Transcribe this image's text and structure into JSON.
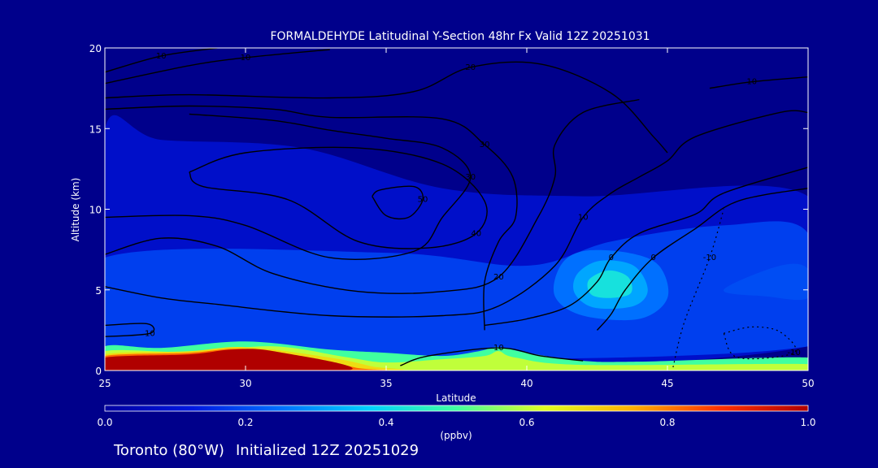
{
  "chart_data": {
    "type": "heatmap",
    "title": "FORMALDEHYDE Latitudinal Y-Section 48hr  Fx Valid 12Z 20251031",
    "xlabel": "Latitude",
    "ylabel": "Altitude (km)",
    "xlim": [
      25,
      50
    ],
    "ylim": [
      0,
      20
    ],
    "x_ticks": [
      "25",
      "30",
      "35",
      "40",
      "45",
      "50"
    ],
    "y_ticks": [
      "0",
      "5",
      "10",
      "15",
      "20"
    ],
    "colorbar": {
      "ticks": [
        "0.0",
        "0.2",
        "0.4",
        "0.6",
        "0.8",
        "1.0"
      ],
      "range": [
        0,
        1
      ],
      "unit": "(ppbv)",
      "colors": [
        "#0000a0",
        "#0018e0",
        "#0070ff",
        "#00d0ff",
        "#40ffa0",
        "#e0ff20",
        "#ffb000",
        "#ff3000",
        "#b00000"
      ]
    },
    "background_color": "#00008b",
    "filled_regions": [
      {
        "value": 0.08,
        "points": [
          [
            25,
            15
          ],
          [
            27,
            14.3
          ],
          [
            32,
            13.8
          ],
          [
            37,
            11.3
          ],
          [
            42,
            10.8
          ],
          [
            50,
            10.8
          ],
          [
            50,
            1.5
          ],
          [
            25,
            1.5
          ]
        ]
      },
      {
        "value": 0.18,
        "points": [
          [
            25,
            7
          ],
          [
            35,
            7.3
          ],
          [
            40,
            6.5
          ],
          [
            43,
            8
          ],
          [
            47,
            9
          ],
          [
            50,
            8.5
          ],
          [
            50,
            1.5
          ],
          [
            25,
            1.5
          ]
        ]
      },
      {
        "value": 0.25,
        "points": [
          [
            41.2,
            6.5
          ],
          [
            42,
            7.4
          ],
          [
            43.6,
            7.3
          ],
          [
            44.7,
            6.5
          ],
          [
            45,
            4.5
          ],
          [
            44,
            3.2
          ],
          [
            42,
            3.4
          ],
          [
            41,
            4.6
          ]
        ]
      },
      {
        "value": 0.32,
        "points": [
          [
            41.8,
            6
          ],
          [
            42.6,
            6.8
          ],
          [
            43.8,
            6.5
          ],
          [
            44.3,
            5
          ],
          [
            43.8,
            4
          ],
          [
            42.4,
            3.9
          ],
          [
            41.7,
            4.8
          ]
        ]
      },
      {
        "value": 0.42,
        "points": [
          [
            42.2,
            5.6
          ],
          [
            42.9,
            6.2
          ],
          [
            43.6,
            5.8
          ],
          [
            43.7,
            4.8
          ],
          [
            43,
            4.5
          ],
          [
            42.3,
            4.7
          ]
        ]
      },
      {
        "value": 0.2,
        "points": [
          [
            47,
            5
          ],
          [
            49,
            6.5
          ],
          [
            50,
            6.3
          ],
          [
            50,
            4.5
          ],
          [
            48.5,
            4.6
          ]
        ]
      },
      {
        "value": 0.5,
        "points": [
          [
            25,
            1.5
          ],
          [
            27,
            1.4
          ],
          [
            30,
            1.8
          ],
          [
            33,
            1.3
          ],
          [
            35,
            1.1
          ],
          [
            37,
            0.9
          ],
          [
            38.3,
            1.2
          ],
          [
            39,
            1.45
          ],
          [
            40,
            1.1
          ],
          [
            42,
            0.6
          ],
          [
            44,
            0.55
          ],
          [
            50,
            0.8
          ],
          [
            50,
            0
          ],
          [
            25,
            0
          ]
        ]
      },
      {
        "value": 0.6,
        "points": [
          [
            25,
            1.2
          ],
          [
            28,
            1.15
          ],
          [
            31,
            1.5
          ],
          [
            33.5,
            0.85
          ],
          [
            35,
            0.5
          ],
          [
            37,
            0.7
          ],
          [
            38.5,
            0.9
          ],
          [
            39,
            1.2
          ],
          [
            39.6,
            0.8
          ],
          [
            42,
            0.35
          ],
          [
            50,
            0.4
          ],
          [
            50,
            0
          ],
          [
            25,
            0
          ]
        ]
      },
      {
        "value": 0.68,
        "points": [
          [
            25,
            1.0
          ],
          [
            28,
            1.2
          ],
          [
            30,
            1.45
          ],
          [
            33,
            0.8
          ],
          [
            34.5,
            0.25
          ],
          [
            35,
            0
          ],
          [
            25,
            0
          ]
        ]
      },
      {
        "value": 0.82,
        "points": [
          [
            25,
            0.9
          ],
          [
            28,
            1.1
          ],
          [
            30,
            1.35
          ],
          [
            32.5,
            0.7
          ],
          [
            34,
            0.15
          ],
          [
            34.5,
            0
          ],
          [
            25,
            0
          ]
        ]
      },
      {
        "value": 1.0,
        "points": [
          [
            25,
            0.8
          ],
          [
            28,
            1.0
          ],
          [
            29.5,
            1.3
          ],
          [
            31,
            1.2
          ],
          [
            33.6,
            0
          ],
          [
            25,
            0
          ]
        ]
      }
    ],
    "contours": [
      {
        "label": "10",
        "style": "solid",
        "points": [
          [
            25,
            18.5
          ],
          [
            27,
            19.5
          ],
          [
            29,
            20
          ]
        ]
      },
      {
        "label": "10",
        "style": "solid",
        "points": [
          [
            25,
            17.8
          ],
          [
            28,
            18.9
          ],
          [
            30,
            19.4
          ],
          [
            33,
            19.9
          ]
        ]
      },
      {
        "label": "20",
        "style": "solid",
        "points": [
          [
            25,
            16.9
          ],
          [
            28,
            17.1
          ],
          [
            33,
            16.9
          ],
          [
            36,
            17.3
          ],
          [
            38,
            18.8
          ],
          [
            40.5,
            19
          ],
          [
            43,
            17.2
          ],
          [
            44.5,
            14.5
          ],
          [
            45,
            13.5
          ]
        ]
      },
      {
        "label": "30",
        "style": "solid",
        "points": [
          [
            25,
            16.2
          ],
          [
            28,
            16.4
          ],
          [
            31,
            16.2
          ],
          [
            33,
            15.7
          ],
          [
            37,
            15.6
          ],
          [
            38.5,
            14
          ],
          [
            39.5,
            12
          ],
          [
            39.6,
            9.5
          ],
          [
            39,
            8
          ],
          [
            38.5,
            5.5
          ],
          [
            38.5,
            2.5
          ]
        ]
      },
      {
        "label": "40",
        "style": "solid",
        "points": [
          [
            28,
            12.3
          ],
          [
            30,
            13.5
          ],
          [
            34,
            13.8
          ],
          [
            37,
            12.8
          ],
          [
            38.5,
            10.5
          ],
          [
            38.2,
            8.5
          ],
          [
            36.5,
            7.6
          ],
          [
            34,
            8
          ],
          [
            31.5,
            10.6
          ],
          [
            28.5,
            11.4
          ],
          [
            28,
            12.3
          ]
        ]
      },
      {
        "label": "50",
        "style": "solid",
        "points": [
          [
            34.5,
            10.8
          ],
          [
            34.8,
            11.2
          ],
          [
            36,
            11.4
          ],
          [
            36.3,
            10.6
          ],
          [
            35.8,
            9.5
          ],
          [
            35,
            9.6
          ],
          [
            34.5,
            10.8
          ]
        ]
      },
      {
        "label": "30",
        "style": "solid",
        "points": [
          [
            25,
            9.5
          ],
          [
            28,
            9.6
          ],
          [
            30,
            9
          ],
          [
            33,
            7
          ],
          [
            36,
            7.4
          ],
          [
            37,
            9.5
          ],
          [
            38,
            12
          ],
          [
            37,
            13.8
          ],
          [
            35,
            14.4
          ],
          [
            33,
            14.9
          ],
          [
            31,
            15.5
          ],
          [
            28,
            15.9
          ]
        ]
      },
      {
        "label": "20",
        "style": "solid",
        "points": [
          [
            25,
            7.2
          ],
          [
            27,
            8.2
          ],
          [
            29,
            7.7
          ],
          [
            31,
            6
          ],
          [
            34,
            4.9
          ],
          [
            37,
            4.9
          ],
          [
            39,
            5.8
          ],
          [
            40.4,
            9.5
          ],
          [
            41,
            12
          ],
          [
            41,
            14
          ],
          [
            42,
            16
          ],
          [
            44,
            16.8
          ]
        ]
      },
      {
        "label": "10",
        "style": "solid",
        "points": [
          [
            25,
            5.2
          ],
          [
            27,
            4.5
          ],
          [
            29,
            4.1
          ],
          [
            33,
            3.4
          ],
          [
            37,
            3.4
          ],
          [
            39,
            4
          ],
          [
            41,
            6.5
          ],
          [
            42,
            9.5
          ],
          [
            43,
            11
          ],
          [
            44,
            12
          ],
          [
            45,
            13
          ],
          [
            46,
            14.5
          ],
          [
            49,
            16
          ],
          [
            50,
            16
          ]
        ]
      },
      {
        "label": "0",
        "style": "solid",
        "points": [
          [
            38.5,
            2.8
          ],
          [
            40,
            3.2
          ],
          [
            41.5,
            4
          ],
          [
            42.5,
            5.5
          ],
          [
            43,
            7
          ],
          [
            44,
            8.5
          ],
          [
            46,
            9.7
          ],
          [
            47,
            11
          ],
          [
            50,
            12.6
          ]
        ]
      },
      {
        "label": "0",
        "style": "solid",
        "points": [
          [
            42.5,
            2.5
          ],
          [
            43,
            3.5
          ],
          [
            43.5,
            5
          ],
          [
            44.5,
            7
          ],
          [
            46,
            8.8
          ],
          [
            47.5,
            10.5
          ],
          [
            50,
            11.3
          ]
        ]
      },
      {
        "label": "10",
        "style": "solid",
        "points": [
          [
            46.5,
            17.5
          ],
          [
            48,
            17.9
          ],
          [
            50,
            18.2
          ]
        ]
      },
      {
        "label": "10",
        "style": "solid",
        "points": [
          [
            25,
            2.8
          ],
          [
            26.5,
            2.9
          ],
          [
            26.6,
            2.3
          ],
          [
            25,
            2.1
          ]
        ]
      },
      {
        "label": "10",
        "style": "solid",
        "points": [
          [
            35.5,
            0.3
          ],
          [
            36.5,
            0.9
          ],
          [
            39,
            1.4
          ],
          [
            40.5,
            0.9
          ],
          [
            42,
            0.6
          ]
        ]
      },
      {
        "label": "-10",
        "style": "dashed",
        "points": [
          [
            45.2,
            0.2
          ],
          [
            45.6,
            3
          ],
          [
            46.5,
            7
          ],
          [
            47,
            10
          ]
        ]
      },
      {
        "label": "-10",
        "style": "dashed",
        "points": [
          [
            47,
            2.3
          ],
          [
            48,
            2.7
          ],
          [
            49,
            2.4
          ],
          [
            49.5,
            1.1
          ],
          [
            47.5,
            0.8
          ],
          [
            47,
            2.3
          ]
        ]
      }
    ],
    "grid": false,
    "legend": "colorbar-bottom"
  },
  "footer": {
    "location": "Toronto (80°W)",
    "initialized": "Initialized 12Z 20251029"
  }
}
